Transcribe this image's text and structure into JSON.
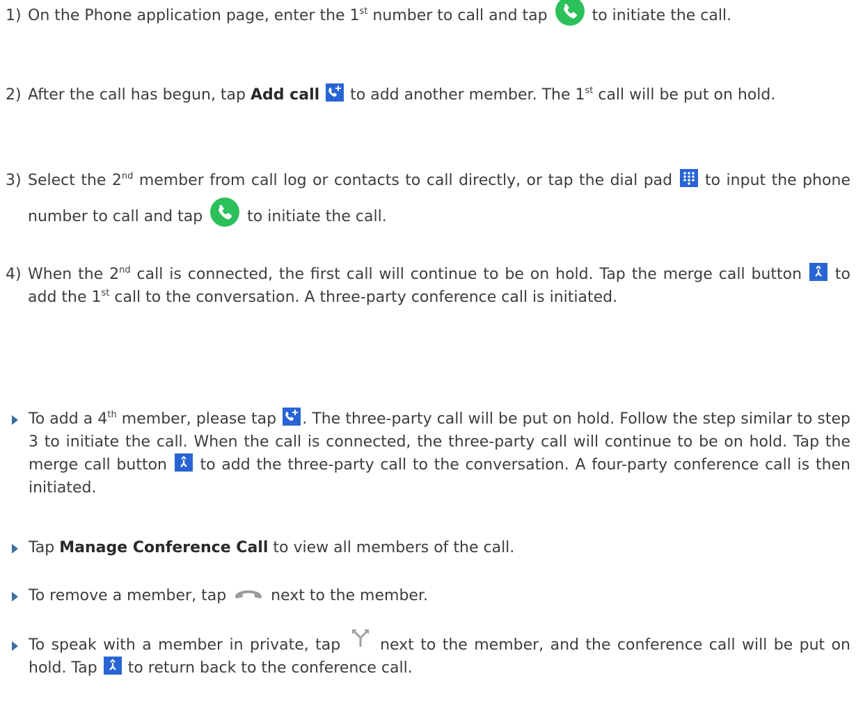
{
  "colors": {
    "text": "#3d3d3d",
    "accent_green": "#2cc05a",
    "icon_blue": "#2864d4",
    "bullet": "#3a6ea5",
    "hangup_gray": "#9a9a9a"
  },
  "icons": {
    "call": "phone-call-icon",
    "add_call": "add-call-icon",
    "dial_pad": "dial-pad-icon",
    "merge": "merge-call-icon",
    "hang_up": "hang-up-icon",
    "split": "split-call-icon"
  },
  "steps": [
    {
      "num": "1)",
      "s1a": "On the Phone application page, enter the 1",
      "s1sup": "st",
      "s1b": " number to call and tap ",
      "s1c": " to initiate the call."
    },
    {
      "num": "2)",
      "s2a": "After the call has begun, tap ",
      "s2bold": "Add call",
      "s2b": " ",
      "s2c": " to add another member. The 1",
      "s2sup": "st",
      "s2d": " call will be put on hold."
    },
    {
      "num": "3)",
      "s3a": "Select the 2",
      "s3sup": "nd",
      "s3b": " member from call log or contacts to call directly, or tap the dial pad ",
      "s3c": " to input the phone number to call and tap ",
      "s3d": " to initiate the call."
    },
    {
      "num": "4)",
      "s4a": "When the 2",
      "s4sup1": "nd",
      "s4b": " call is connected, the first call will continue to be on hold. Tap the merge call button ",
      "s4c": " to add the 1",
      "s4sup2": "st",
      "s4d": " call to the conversation. A three-party conference call is initiated."
    }
  ],
  "bullets": [
    {
      "b1a": "To add a 4",
      "b1sup": "th",
      "b1b": " member, please tap ",
      "b1c": ". The three-party call will be put on hold. Follow the step similar to step 3 to initiate the call. When the call is connected, the three-party call will continue to be on hold. Tap the merge call button ",
      "b1d": " to add the three-party call to the conversation. A four-party conference call is then initiated."
    },
    {
      "b2a": "Tap ",
      "b2bold": "Manage Conference Call",
      "b2b": " to view all members of the call."
    },
    {
      "b3a": "To remove a member, tap ",
      "b3b": " next to the member."
    },
    {
      "b4a": "To speak with a member in private, tap ",
      "b4b": " next to the member, and the conference call will be put on hold. Tap ",
      "b4c": " to return back to the conference call."
    }
  ]
}
